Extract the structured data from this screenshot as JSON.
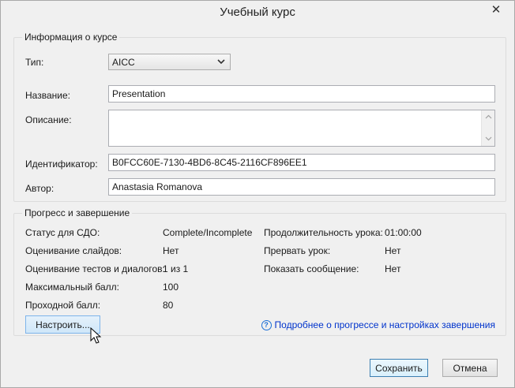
{
  "window": {
    "title": "Учебный курс",
    "close_glyph": "✕"
  },
  "course_info": {
    "legend": "Информация о курсе",
    "type_label": "Тип:",
    "type_value": "AICC",
    "name_label": "Название:",
    "name_value": "Presentation",
    "description_label": "Описание:",
    "description_value": "",
    "id_label": "Идентификатор:",
    "id_value": "B0FCC60E-7130-4BD6-8C45-2116CF896EE1",
    "author_label": "Автор:",
    "author_value": "Anastasia Romanova"
  },
  "progress": {
    "legend": "Прогресс и завершение",
    "lms_status_label": "Статус для СДО:",
    "lms_status_value": "Complete/Incomplete",
    "slide_scoring_label": "Оценивание слайдов:",
    "slide_scoring_value": "Нет",
    "quiz_scoring_label": "Оценивание тестов и диалогов:",
    "quiz_scoring_value": "1 из 1",
    "max_score_label": "Максимальный балл:",
    "max_score_value": "100",
    "passing_score_label": "Проходной балл:",
    "passing_score_value": "80",
    "duration_label": "Продолжительность урока:",
    "duration_value": "01:00:00",
    "interrupt_label": "Прервать урок:",
    "interrupt_value": "Нет",
    "show_message_label": "Показать сообщение:",
    "show_message_value": "Нет",
    "configure_button": "Настроить...",
    "help_icon_glyph": "?",
    "help_link": "Подробнее о прогрессе и настройках завершения"
  },
  "footer": {
    "save_button": "Сохранить",
    "cancel_button": "Отмена"
  },
  "icons": {
    "close": "close-icon",
    "dropdown": "chevron-down-icon",
    "help": "question-circle-icon",
    "cursor": "mouse-pointer-icon"
  },
  "colors": {
    "link": "#0033cc",
    "primary_border": "#3c7fb1",
    "background": "#f0f0f0"
  }
}
